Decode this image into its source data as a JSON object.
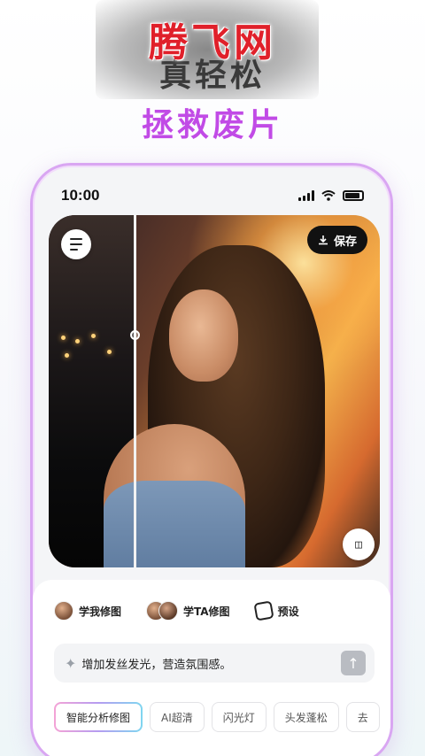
{
  "promo": {
    "watermark": "腾飞网",
    "headline_1": "真轻松",
    "headline_2": "拯救废片"
  },
  "status_bar": {
    "time": "10:00"
  },
  "photo_toolbar": {
    "save_label": "保存",
    "compare_label": "◫"
  },
  "modes": [
    {
      "label": "学我修图"
    },
    {
      "label": "学TA修图"
    },
    {
      "label": "预设"
    }
  ],
  "prompt": {
    "text": "增加发丝发光，营造氛围感。"
  },
  "chips": [
    {
      "label": "智能分析修图",
      "active": true
    },
    {
      "label": "AI超清"
    },
    {
      "label": "闪光灯"
    },
    {
      "label": "头发蓬松"
    },
    {
      "label": "去"
    }
  ],
  "colors": {
    "accent_gradient": [
      "#f4a3d6",
      "#b59cf0",
      "#7fd6f0"
    ],
    "headline_purple": "#c14be6",
    "watermark_red": "#e0202a"
  },
  "icons": {
    "menu": "hamburger-icon",
    "save": "download-icon",
    "compare": "compare-icon",
    "sparkle": "sparkle-icon",
    "send": "arrow-up-icon",
    "preset": "preset-icon"
  }
}
